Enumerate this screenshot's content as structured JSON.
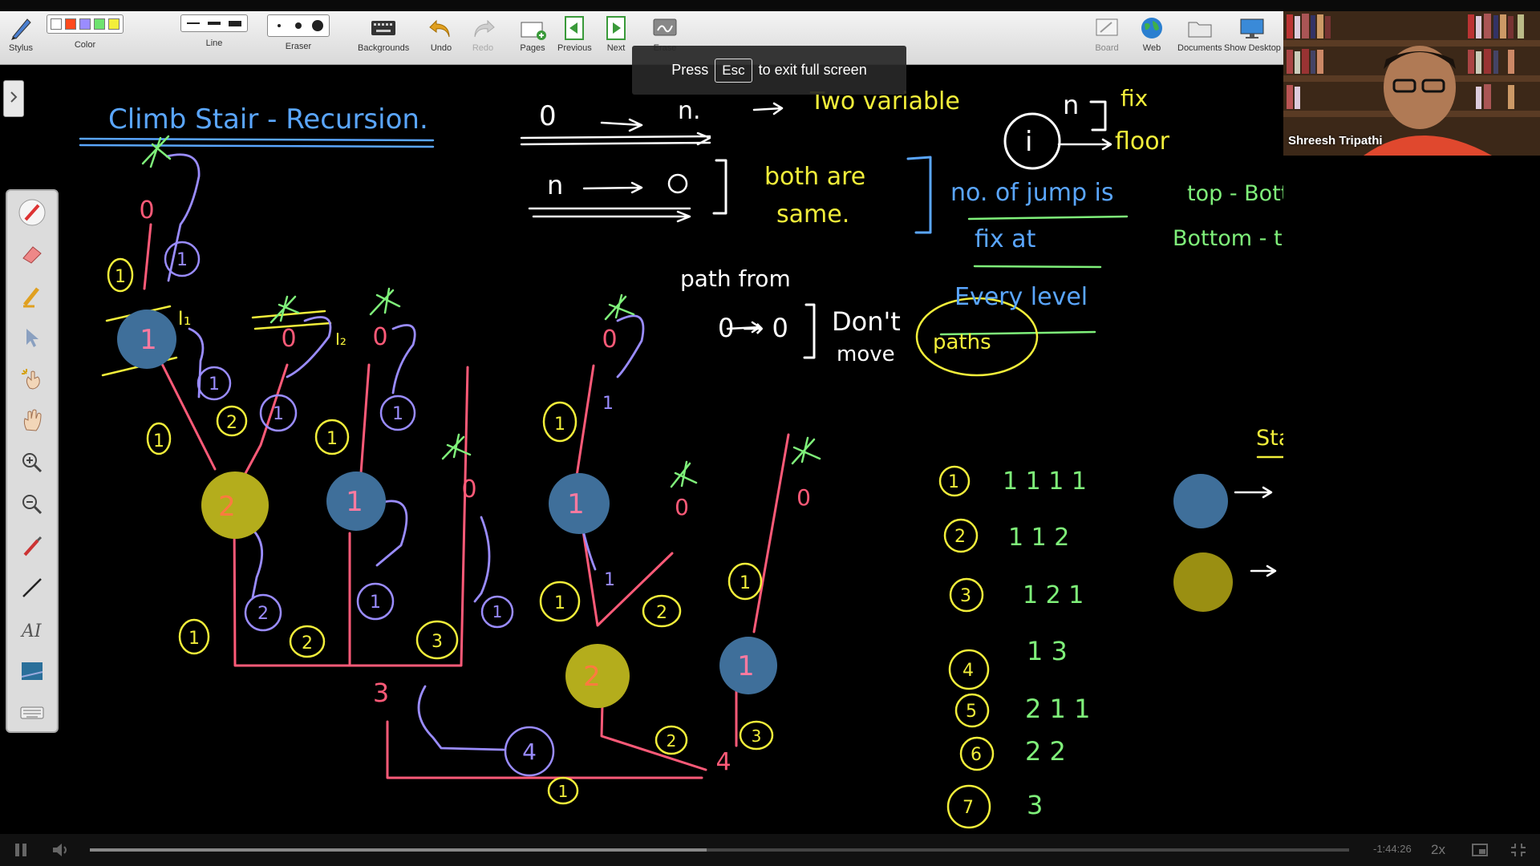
{
  "toolbar": {
    "stylus": "Stylus",
    "color": "Color",
    "line": "Line",
    "eraser": "Eraser",
    "backgrounds": "Backgrounds",
    "undo": "Undo",
    "redo": "Redo",
    "pages": "Pages",
    "previous": "Previous",
    "next": "Next",
    "erase": "Erase",
    "board": "Board",
    "web": "Web",
    "documents": "Documents",
    "show_desktop": "Show Desktop",
    "colors": [
      "#ffffff",
      "#ff4a1c",
      "#9a8cff",
      "#6fe36f",
      "#f2ee3a"
    ]
  },
  "fullscreen_toast": {
    "press": "Press",
    "key": "Esc",
    "rest": "to exit full screen"
  },
  "webcam": {
    "name": "Shreesh Tripathi"
  },
  "player": {
    "time_remaining": "-1:44:26",
    "speed": "2x",
    "progress_fraction": 0.49
  },
  "whiteboard": {
    "title": "Climb Stair - Recursion.",
    "top_zero": "0",
    "top_n": "n.",
    "two_variable": "Two variable",
    "n_sym": "n",
    "fix": "fix",
    "i_sym": "i",
    "floor": "floor",
    "n_row2": "n",
    "zero_row2": "0",
    "both_are": "both are",
    "same": "same.",
    "no_of_jump": "no. of jump is",
    "fix_at": "fix at",
    "every_level": "Every level",
    "top_bottom": "top - Bottom",
    "bottom_top": "Bottom - top",
    "path_from": "path from",
    "path_zero": "0 → 0",
    "dont": "Don't",
    "move": "move",
    "paths": "paths",
    "stair": "Stair",
    "legend_blue": "1",
    "legend_yellow": "2",
    "paths_list": [
      {
        "num": "1",
        "seq": "1 1 1 1"
      },
      {
        "num": "2",
        "seq": "1 1 2"
      },
      {
        "num": "3",
        "seq": "1 2 1"
      },
      {
        "num": "4",
        "seq": "1 3"
      },
      {
        "num": "5",
        "seq": "2 1 1"
      },
      {
        "num": "6",
        "seq": "2 2"
      },
      {
        "num": "7",
        "seq": "3"
      }
    ]
  }
}
